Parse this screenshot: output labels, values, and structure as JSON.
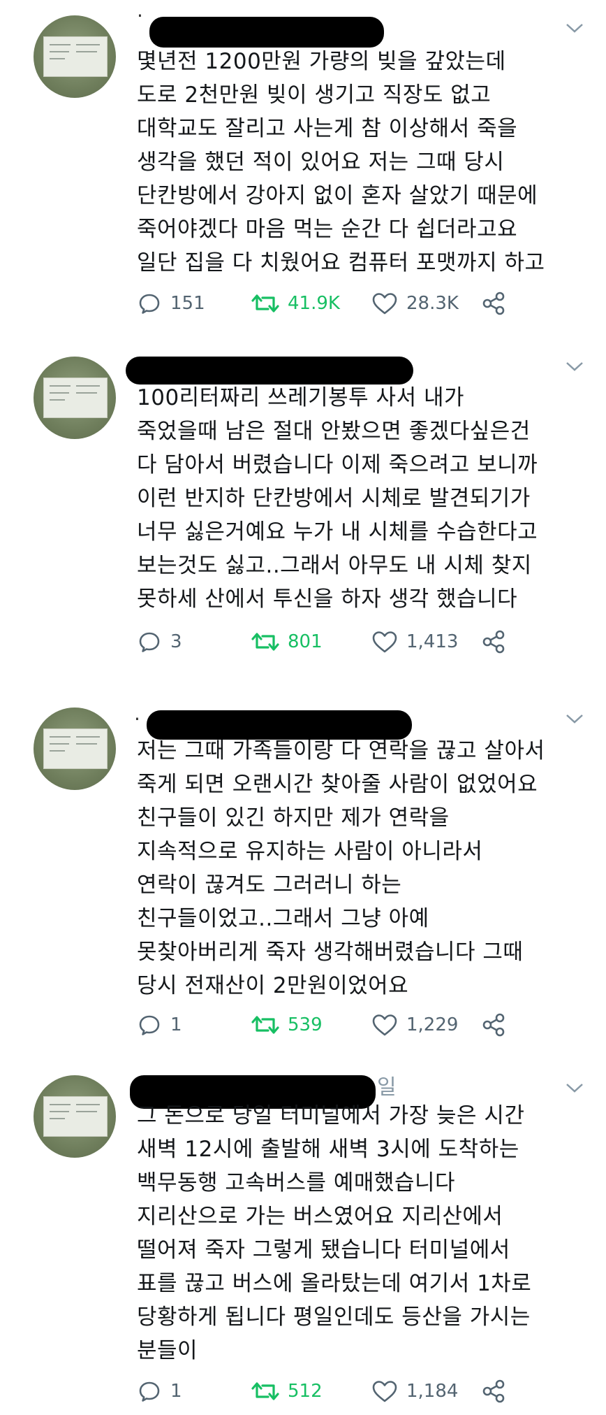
{
  "tweets": [
    {
      "text": "몇년전 1200만원 가량의 빚을 갚았는데\n도로 2천만원 빚이 생기고 직장도 없고\n대학교도 잘리고 사는게 참 이상해서 죽을\n생각을 했던 적이 있어요 저는 그때 당시\n단칸방에서 강아지 없이 혼자 살았기 때문에\n죽어야겠다 마음 먹는 순간 다 쉽더라고요\n일단 집을 다 치웠어요 컴퓨터 포맷까지 하고",
      "replies": "151",
      "retweets": "41.9K",
      "likes": "28.3K"
    },
    {
      "text": "100리터짜리 쓰레기봉투 사서 내가\n죽었을때 남은 절대 안봤으면 좋겠다싶은건\n다 담아서 버렸습니다 이제 죽으려고 보니까\n이런 반지하 단칸방에서 시체로 발견되기가\n너무 싫은거예요 누가 내 시체를 수습한다고\n보는것도 싫고..그래서 아무도 내 시체 찾지\n못하세 산에서 투신을 하자 생각 했습니다",
      "replies": "3",
      "retweets": "801",
      "likes": "1,413"
    },
    {
      "text": "저는 그때 가족들이랑 다 연락을 끊고 살아서\n죽게 되면 오랜시간 찾아줄 사람이 없었어요\n친구들이 있긴 하지만 제가 연락을\n지속적으로 유지하는 사람이 아니라서\n연락이 끊겨도 그러러니 하는\n친구들이었고..그래서 그냥 아예\n못찾아버리게 죽자 생각해버렸습니다 그때\n당시 전재산이 2만원이었어요",
      "replies": "1",
      "retweets": "539",
      "likes": "1,229"
    },
    {
      "text": "그 돈으로 당일 터미널에서 가장 늦은 시간\n새벽 12시에 출발해 새벽 3시에 도착하는\n백무동행 고속버스를 예매했습니다\n지리산으로 가는 버스였어요 지리산에서\n떨어져 죽자 그렇게 됐습니다 터미널에서\n표를 끊고 버스에 올라탔는데 여기서 1차로\n당황하게 됩니다 평일인데도 등산을 가시는\n분들이",
      "replies": "1",
      "retweets": "512",
      "likes": "1,184",
      "header_fragment": "일"
    }
  ],
  "icons": {
    "reply": "reply-bubble-icon",
    "retweet": "retweet-icon",
    "like": "heart-icon",
    "share": "share-icon",
    "menu": "chevron-down-icon"
  },
  "colors": {
    "text": "#14171a",
    "muted": "#536471",
    "retweet": "#17bf63"
  }
}
